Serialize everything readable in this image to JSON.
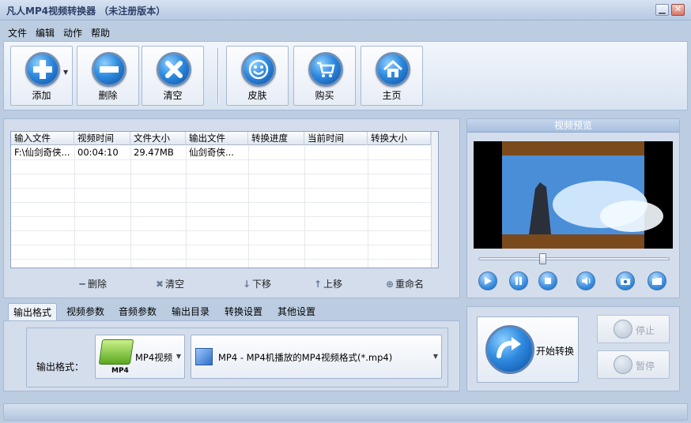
{
  "window": {
    "title": "凡人MP4视频转换器 （未注册版本）"
  },
  "menu": [
    "文件",
    "编辑",
    "动作",
    "帮助"
  ],
  "toolbar": {
    "add": "添加",
    "delete": "删除",
    "clear": "清空",
    "skin": "皮肤",
    "buy": "购买",
    "home": "主页"
  },
  "file_table": {
    "columns": [
      "输入文件",
      "视频时间",
      "文件大小",
      "输出文件",
      "转换进度",
      "当前时间",
      "转换大小"
    ],
    "rows": [
      [
        "F:\\仙剑奇侠...",
        "00:04:10",
        "29.47MB",
        "仙剑奇侠...",
        "",
        "",
        ""
      ]
    ]
  },
  "list_actions": {
    "delete": "删除",
    "clear": "清空",
    "down": "下移",
    "up": "上移",
    "rename": "重命名"
  },
  "tabs": [
    "输出格式",
    "视频参数",
    "音频参数",
    "输出目录",
    "转换设置",
    "其他设置"
  ],
  "format": {
    "label": "输出格式：",
    "category": "MP4视频",
    "category_icon_text": "MP4",
    "profile": "MP4 - MP4机播放的MP4视频格式(*.mp4)"
  },
  "preview": {
    "title": "视频预览",
    "position": 0.33
  },
  "actions": {
    "start": "开始转换",
    "stop": "停止",
    "pause": "暂停"
  },
  "colors": {
    "accent": "#2f8be0",
    "panel": "#d3ddec",
    "background": "#bccde2"
  }
}
